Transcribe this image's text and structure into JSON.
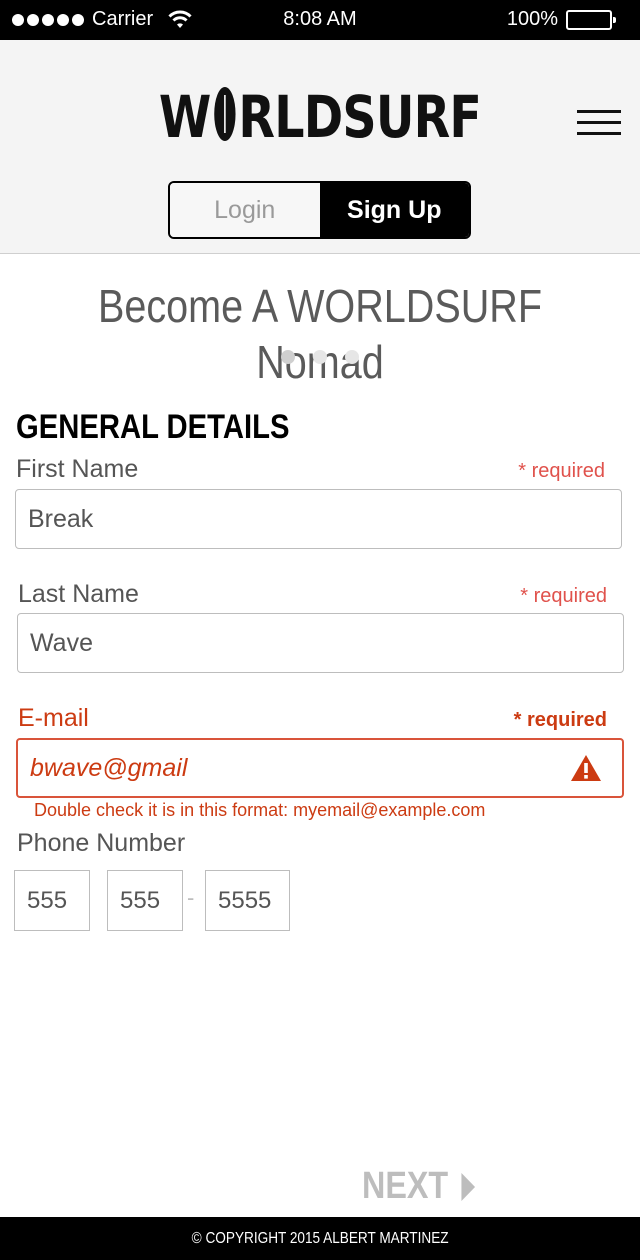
{
  "status_bar": {
    "carrier": "Carrier",
    "time": "8:08 AM",
    "battery": "100%"
  },
  "header": {
    "logo_left": "W",
    "logo_right": "RLDSURF",
    "tabs": {
      "login": "Login",
      "signup": "Sign Up"
    },
    "active_tab": "signup"
  },
  "hero": {
    "title": "Become A WORLDSURF Nomad",
    "page_count": 3,
    "active_page": 1
  },
  "form": {
    "section_title": "GENERAL DETAILS",
    "first_name": {
      "label": "First Name",
      "required": "* required",
      "value": "Break"
    },
    "last_name": {
      "label": "Last Name",
      "required": "* required",
      "value": "Wave"
    },
    "email": {
      "label": "E-mail",
      "required": "* required",
      "value": "bwave@gmail",
      "error_message": "Double check it is in this format: myemail@example.com"
    },
    "phone": {
      "label": "Phone Number",
      "area": "555",
      "prefix": "555",
      "dash": "-",
      "line": "5555"
    }
  },
  "next_label": "NEXT",
  "footer": {
    "copyright": "© COPYRIGHT 2015 ALBERT MARTINEZ"
  },
  "colors": {
    "accent": "#000000",
    "error": "#cc3b12",
    "required": "#e0524c",
    "disabled": "#bdbdbd"
  }
}
